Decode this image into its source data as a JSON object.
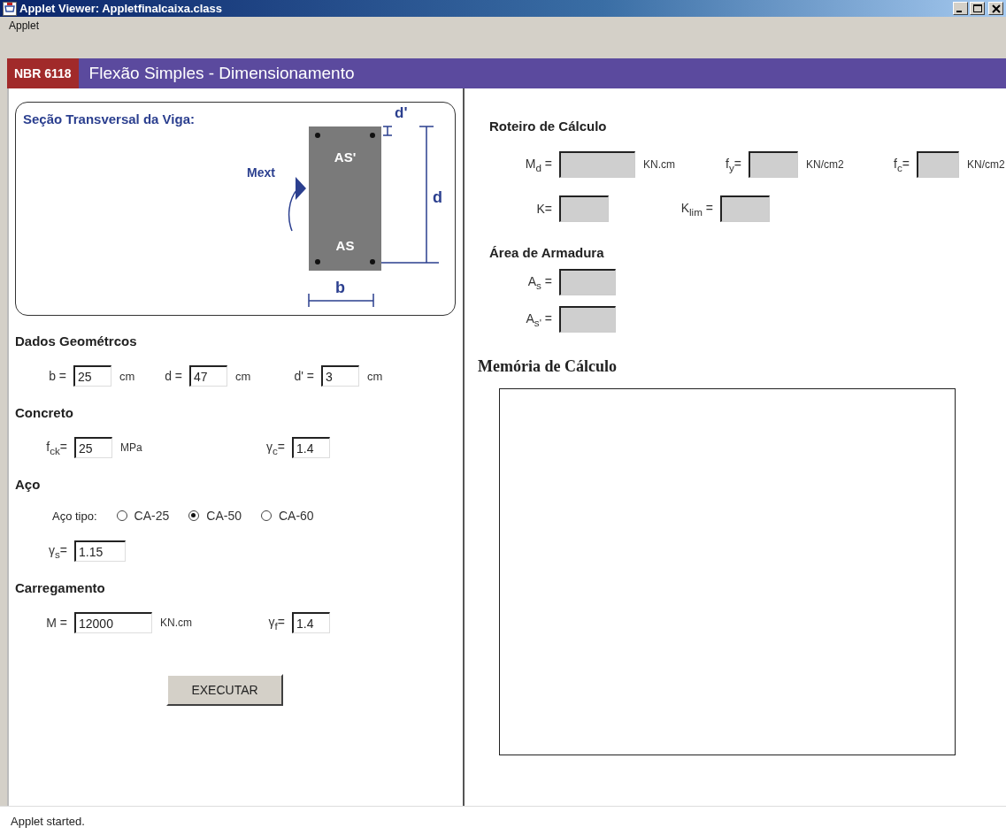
{
  "window": {
    "title": "Applet Viewer: Appletfinalcaixa.class"
  },
  "menu_bar": {
    "items": [
      "Applet"
    ]
  },
  "header": {
    "badge": "NBR 6118",
    "title": "Flexão Simples - Dimensionamento"
  },
  "section_diagram": {
    "title": "Seção Transversal da Viga:",
    "moment_label": "Mext",
    "top_steel_label": "AS'",
    "bottom_steel_label": "AS",
    "cover_label": "d'",
    "depth_label": "d",
    "width_label": "b"
  },
  "geometry": {
    "title": "Dados Geométrcos",
    "fields": [
      {
        "label": "b =",
        "value": "25",
        "unit": "cm"
      },
      {
        "label": "d =",
        "value": "47",
        "unit": "cm"
      },
      {
        "label": "d' =",
        "value": "3",
        "unit": "cm"
      }
    ]
  },
  "concrete": {
    "title": "Concreto",
    "fields": [
      {
        "label": "f$_{ck}$=",
        "value": "25",
        "unit": "MPa"
      },
      {
        "label": "γ$_{c}$=",
        "value": "1.4"
      }
    ]
  },
  "steel": {
    "title": "Aço",
    "type_label": "Aço tipo:",
    "options": [
      {
        "label": "CA-25",
        "selected": false
      },
      {
        "label": "CA-50",
        "selected": true
      },
      {
        "label": "CA-60",
        "selected": false
      }
    ],
    "fields": [
      {
        "label": "γ$_{s}$=",
        "value": "1.15"
      }
    ]
  },
  "loading": {
    "title": "Carregamento",
    "fields": [
      {
        "label": "M =",
        "value": "12000",
        "unit": "KN.cm"
      },
      {
        "label": "γ$_{f}$=",
        "value": "1.4"
      }
    ]
  },
  "execute_button": "EXECUTAR",
  "calculation": {
    "title": "Roteiro de Cálculo",
    "rows": [
      [
        {
          "label": "M$_{d}$ =",
          "unit": "KN.cm"
        },
        {
          "label": "f$_{y}$=",
          "unit": "KN/cm2"
        },
        {
          "label": "f$_{c}$=",
          "unit": "KN/cm2"
        }
      ],
      [
        {
          "label": "K="
        },
        {
          "label": "K$_{lim}$ ="
        }
      ]
    ]
  },
  "reinforcement": {
    "title": "Área de Armadura",
    "fields": [
      {
        "label": "A$_{s}$ ="
      },
      {
        "label": "A$_{s'}$ ="
      }
    ]
  },
  "memory": {
    "title": "Memória de Cálculo"
  },
  "status_bar": "Applet started."
}
